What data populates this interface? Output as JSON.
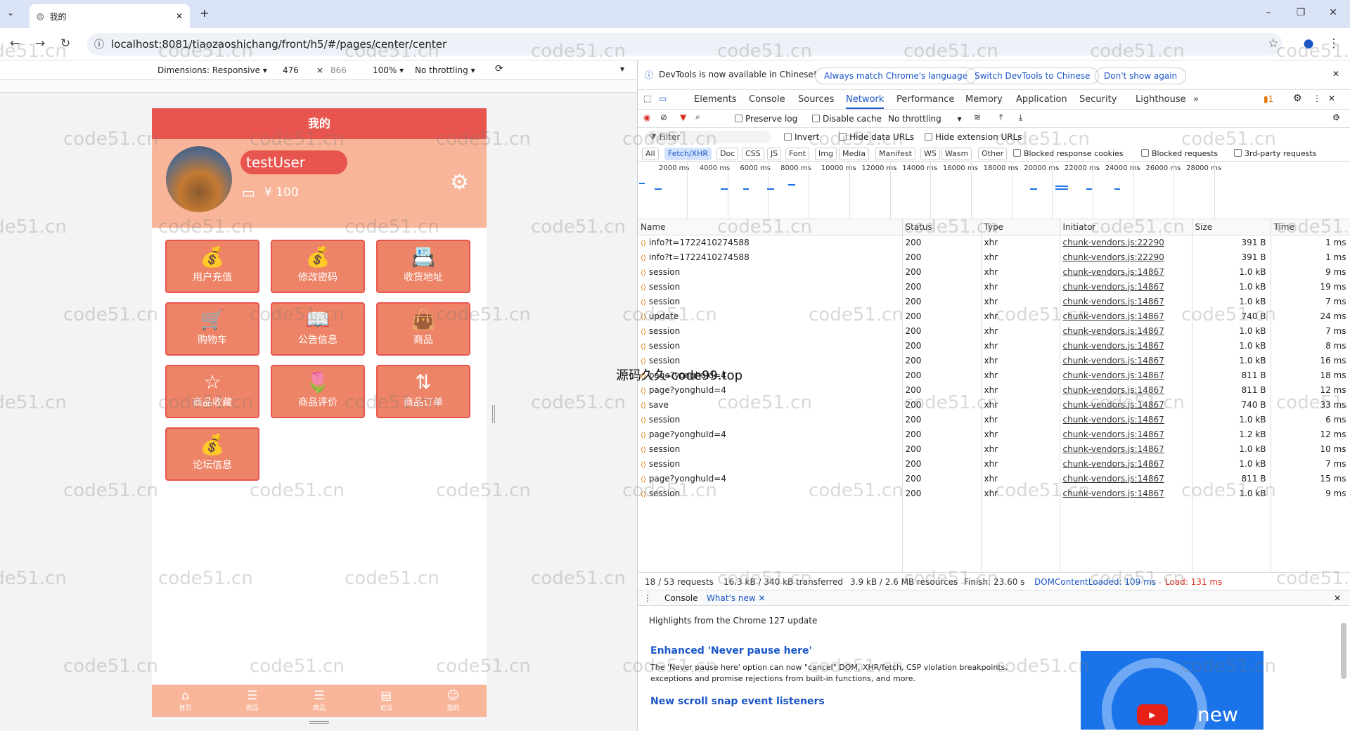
{
  "browser": {
    "tab_title": "我的",
    "url": "localhost:8081/tiaozaoshichang/front/h5/#/pages/center/center"
  },
  "devtoolbar": {
    "dimensions": "Dimensions: Responsive ▾",
    "width": "476",
    "x": "×",
    "height": "866",
    "zoom": "100% ▾",
    "throttle": "No throttling ▾"
  },
  "phone": {
    "header": "我的",
    "username": "testUser",
    "balance": "¥ 100",
    "menu": [
      {
        "label": "用户充值",
        "icon": "money-bag-icon",
        "glyph": "💰"
      },
      {
        "label": "修改密码",
        "icon": "money-bag-icon",
        "glyph": "💰"
      },
      {
        "label": "收货地址",
        "icon": "address-icon",
        "glyph": "📇"
      },
      {
        "label": "购物车",
        "icon": "cart-icon",
        "glyph": "🛒"
      },
      {
        "label": "公告信息",
        "icon": "notice-icon",
        "glyph": "📖"
      },
      {
        "label": "商品",
        "icon": "bag-icon",
        "glyph": "👜"
      },
      {
        "label": "商品收藏",
        "icon": "star-icon",
        "glyph": "☆"
      },
      {
        "label": "商品评价",
        "icon": "flower-icon",
        "glyph": "🌷"
      },
      {
        "label": "商品订单",
        "icon": "sort-icon",
        "glyph": "⇅"
      },
      {
        "label": "论坛信息",
        "icon": "money-bag-icon",
        "glyph": "💰"
      }
    ],
    "bottomnav": [
      {
        "label": "首页",
        "glyph": "⌂"
      },
      {
        "label": "商品",
        "glyph": "☰"
      },
      {
        "label": "商品",
        "glyph": "☰"
      },
      {
        "label": "论坛",
        "glyph": "▤"
      },
      {
        "label": "我的",
        "glyph": "☺"
      }
    ]
  },
  "devtools": {
    "notice": "DevTools is now available in Chinese!",
    "btn_match": "Always match Chrome's language",
    "btn_switch": "Switch DevTools to Chinese",
    "btn_dont": "Don't show again",
    "tabs": [
      "Elements",
      "Console",
      "Sources",
      "Network",
      "Performance",
      "Memory",
      "Application",
      "Security",
      "Lighthouse"
    ],
    "more": "»",
    "issues": "1",
    "preserve_log": "Preserve log",
    "disable_cache": "Disable cache",
    "throttling": "No throttling",
    "filter": "Filter",
    "invert": "Invert",
    "hide_data": "Hide data URLs",
    "hide_ext": "Hide extension URLs",
    "types": [
      "All",
      "Fetch/XHR",
      "Doc",
      "CSS",
      "JS",
      "Font",
      "Img",
      "Media",
      "Manifest",
      "WS",
      "Wasm",
      "Other"
    ],
    "blocked_cookies": "Blocked response cookies",
    "blocked_requests": "Blocked requests",
    "third_party": "3rd-party requests",
    "timeline": [
      "2000 ms",
      "4000 ms",
      "6000 ms",
      "8000 ms",
      "10000 ms",
      "12000 ms",
      "14000 ms",
      "16000 ms",
      "18000 ms",
      "20000 ms",
      "22000 ms",
      "24000 ms",
      "26000 ms",
      "28000 ms"
    ],
    "columns": [
      "Name",
      "Status",
      "Type",
      "Initiator",
      "Size",
      "Time"
    ],
    "rows": [
      [
        "info?t=1722410274588",
        "200",
        "xhr",
        "chunk-vendors.js:22290",
        "391 B",
        "1 ms"
      ],
      [
        "info?t=1722410274588",
        "200",
        "xhr",
        "chunk-vendors.js:22290",
        "391 B",
        "1 ms"
      ],
      [
        "session",
        "200",
        "xhr",
        "chunk-vendors.js:14867",
        "1.0 kB",
        "9 ms"
      ],
      [
        "session",
        "200",
        "xhr",
        "chunk-vendors.js:14867",
        "1.0 kB",
        "19 ms"
      ],
      [
        "session",
        "200",
        "xhr",
        "chunk-vendors.js:14867",
        "1.0 kB",
        "7 ms"
      ],
      [
        "update",
        "200",
        "xhr",
        "chunk-vendors.js:14867",
        "740 B",
        "24 ms"
      ],
      [
        "session",
        "200",
        "xhr",
        "chunk-vendors.js:14867",
        "1.0 kB",
        "7 ms"
      ],
      [
        "session",
        "200",
        "xhr",
        "chunk-vendors.js:14867",
        "1.0 kB",
        "8 ms"
      ],
      [
        "session",
        "200",
        "xhr",
        "chunk-vendors.js:14867",
        "1.0 kB",
        "16 ms"
      ],
      [
        "page?yonghuId=4",
        "200",
        "xhr",
        "chunk-vendors.js:14867",
        "811 B",
        "18 ms"
      ],
      [
        "page?yonghuId=4",
        "200",
        "xhr",
        "chunk-vendors.js:14867",
        "811 B",
        "12 ms"
      ],
      [
        "save",
        "200",
        "xhr",
        "chunk-vendors.js:14867",
        "740 B",
        "33 ms"
      ],
      [
        "session",
        "200",
        "xhr",
        "chunk-vendors.js:14867",
        "1.0 kB",
        "6 ms"
      ],
      [
        "page?yonghuId=4",
        "200",
        "xhr",
        "chunk-vendors.js:14867",
        "1.2 kB",
        "12 ms"
      ],
      [
        "session",
        "200",
        "xhr",
        "chunk-vendors.js:14867",
        "1.0 kB",
        "10 ms"
      ],
      [
        "session",
        "200",
        "xhr",
        "chunk-vendors.js:14867",
        "1.0 kB",
        "7 ms"
      ],
      [
        "page?yonghuId=4",
        "200",
        "xhr",
        "chunk-vendors.js:14867",
        "811 B",
        "15 ms"
      ],
      [
        "session",
        "200",
        "xhr",
        "chunk-vendors.js:14867",
        "1.0 kB",
        "9 ms"
      ]
    ],
    "status": {
      "requests": "18 / 53 requests",
      "transferred": "16.3 kB / 340 kB transferred",
      "resources": "3.9 kB / 2.6 MB resources",
      "finish": "Finish: 23.60 s",
      "dcl": "DOMContentLoaded: 109 ms",
      "load": "Load: 131 ms"
    },
    "drawer": {
      "console": "Console",
      "whatsnew": "What's new",
      "highlights": "Highlights from the Chrome 127 update",
      "h1": "Enhanced 'Never pause here'",
      "p1": "The 'Never pause here' option can now \"cancel\" DOM, XHR/fetch, CSP violation breakpoints, exceptions and promise rejections from built-in functions, and more.",
      "h2": "New scroll snap event listeners",
      "video_label": "new"
    }
  },
  "watermark": "code51.cn",
  "center_watermark": "源码久久-code99.top"
}
